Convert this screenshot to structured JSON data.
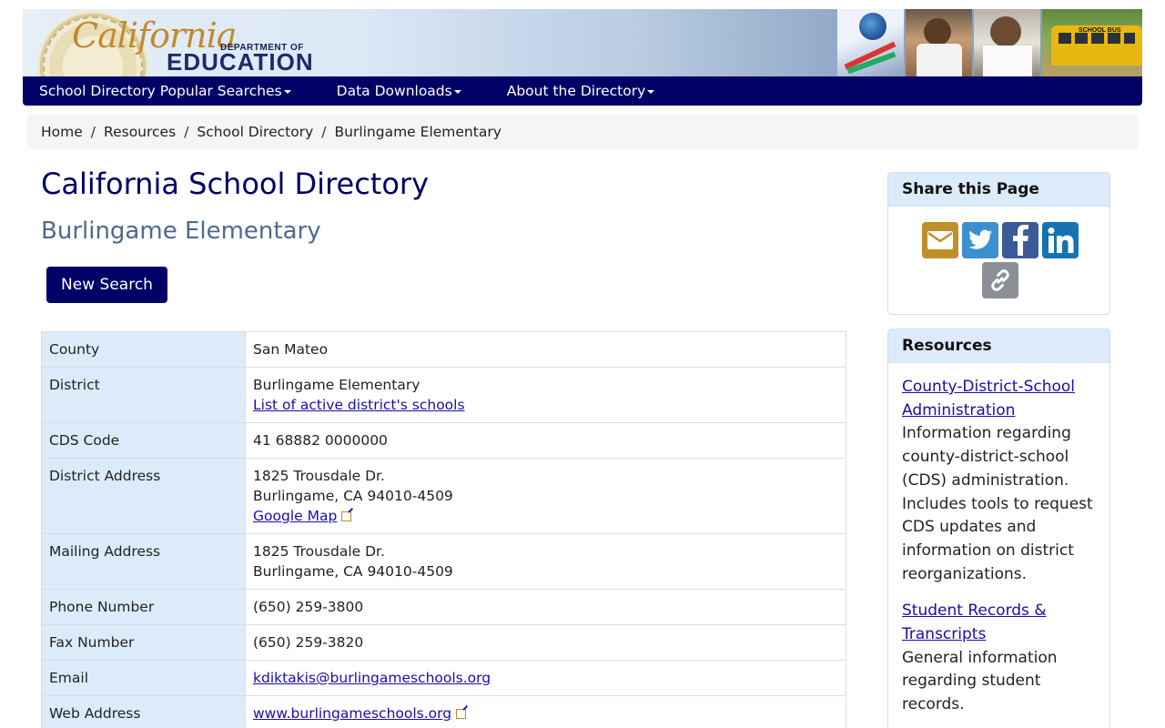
{
  "header": {
    "logo_script": "California",
    "logo_dept": "DEPARTMENT OF",
    "logo_edu": "EDUCATION",
    "bus_sign": "SCHOOL BUS"
  },
  "nav": {
    "items": [
      {
        "label": "School Directory Popular Searches"
      },
      {
        "label": "Data Downloads"
      },
      {
        "label": "About the Directory"
      }
    ]
  },
  "breadcrumb": [
    "Home",
    "Resources",
    "School Directory",
    "Burlingame Elementary"
  ],
  "main": {
    "title": "California School Directory",
    "subtitle": "Burlingame Elementary",
    "new_search_label": "New Search"
  },
  "details": {
    "county_label": "County",
    "county_value": "San Mateo",
    "district_label": "District",
    "district_value": "Burlingame Elementary",
    "district_link": "List of active district's schools",
    "cds_label": "CDS Code",
    "cds_value": "41 68882 0000000",
    "district_address_label": "District Address",
    "district_address_line1": "1825 Trousdale Dr.",
    "district_address_line2": "Burlingame, CA 94010-4509",
    "google_map_link": "Google Map",
    "mailing_address_label": "Mailing Address",
    "mailing_address_line1": "1825 Trousdale Dr.",
    "mailing_address_line2": "Burlingame, CA 94010-4509",
    "phone_label": "Phone Number",
    "phone_value": "(650) 259-3800",
    "fax_label": "Fax Number",
    "fax_value": "(650) 259-3820",
    "email_label": "Email",
    "email_value": "kdiktakis@burlingameschools.org",
    "web_label": "Web Address",
    "web_value": "www.burlingameschools.org"
  },
  "share": {
    "title": "Share this Page",
    "icons": [
      "email-icon",
      "twitter-icon",
      "facebook-icon",
      "linkedin-icon",
      "link-icon"
    ]
  },
  "resources": {
    "title": "Resources",
    "item1_link_line1": "County-District-School",
    "item1_link_line2": "Administration",
    "item1_desc": "Information regarding county-district-school (CDS) administration. Includes tools to request CDS updates and information on district reorganizations.",
    "item2_link_line1": "Student Records &",
    "item2_link_line2": "Transcripts",
    "item2_desc": "General information regarding student records."
  },
  "colors": {
    "nav_bg": "#000066",
    "key_cell_bg": "#dcebfa",
    "link": "#1a0dab",
    "subtitle": "#4d6a8f"
  }
}
